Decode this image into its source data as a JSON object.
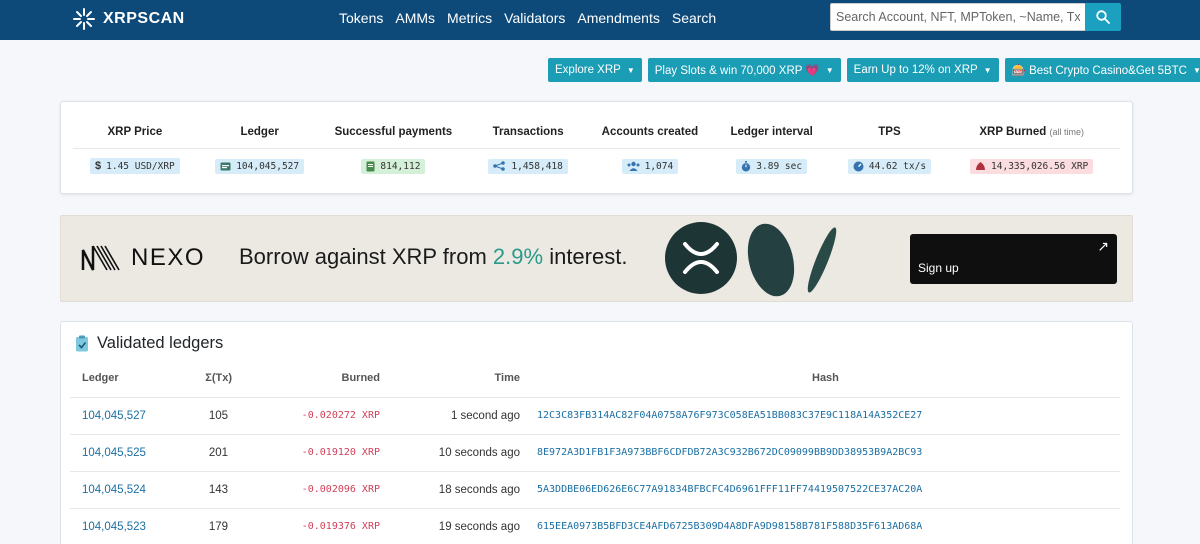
{
  "header": {
    "logo_text": "XRPSCAN",
    "nav": [
      "Tokens",
      "AMMs",
      "Metrics",
      "Validators",
      "Amendments",
      "Search"
    ],
    "search_placeholder": "Search Account, NFT, MPToken, ~Name, Tx H..."
  },
  "promos": [
    {
      "label": "Explore XRP"
    },
    {
      "label": "Play Slots & win 70,000 XRP 💗"
    },
    {
      "label": "Earn Up to 12% on XRP"
    },
    {
      "label": "🎰 Best Crypto Casino&Get 5BTC"
    }
  ],
  "stats": [
    {
      "label": "XRP Price",
      "value": "1.45 USD/XRP",
      "icon": "dollar-icon",
      "color": "blue"
    },
    {
      "label": "Ledger",
      "value": "104,045,527",
      "icon": "ledger-icon",
      "color": "blue"
    },
    {
      "label": "Successful payments",
      "value": "814,112",
      "icon": "payment-icon",
      "color": "green"
    },
    {
      "label": "Transactions",
      "value": "1,458,418",
      "icon": "network-icon",
      "color": "blue"
    },
    {
      "label": "Accounts created",
      "value": "1,074",
      "icon": "users-icon",
      "color": "blue"
    },
    {
      "label": "Ledger interval",
      "value": "3.89 sec",
      "icon": "stopwatch-icon",
      "color": "blue"
    },
    {
      "label": "TPS",
      "value": "44.62 tx/s",
      "icon": "gauge-icon",
      "color": "blue"
    },
    {
      "label": "XRP Burned",
      "sub": "(all time)",
      "value": "14,335,026.56 XRP",
      "icon": "fire-icon",
      "color": "red"
    }
  ],
  "banner": {
    "brand": "NEXO",
    "tagline_pre": "Borrow against XRP from ",
    "tagline_hl": "2.9%",
    "tagline_post": " interest.",
    "cta": "Sign up"
  },
  "ledgers": {
    "title": "Validated ledgers",
    "columns": {
      "ledger": "Ledger",
      "tx": "Σ(Tx)",
      "burned": "Burned",
      "time": "Time",
      "hash": "Hash"
    },
    "rows": [
      {
        "ledger": "104,045,527",
        "tx": "105",
        "burned": "-0.020272 XRP",
        "time": "1 second ago",
        "hash": "12C3C83FB314AC82F04A0758A76F973C058EA51BB083C37E9C118A14A352CE27"
      },
      {
        "ledger": "104,045,525",
        "tx": "201",
        "burned": "-0.019120 XRP",
        "time": "10 seconds ago",
        "hash": "8E972A3D1FB1F3A973BBF6CDFDB72A3C932B672DC09099BB9DD38953B9A2BC93"
      },
      {
        "ledger": "104,045,524",
        "tx": "143",
        "burned": "-0.002096 XRP",
        "time": "18 seconds ago",
        "hash": "5A3DDBE06ED626E6C77A91834BFBCFC4D6961FFF11FF74419507522CE37AC20A"
      },
      {
        "ledger": "104,045,523",
        "tx": "179",
        "burned": "-0.019376 XRP",
        "time": "19 seconds ago",
        "hash": "615EEA0973B5BFD3CE4AFD6725B309D4A8DFA9D98158B781F588D35F613AD68A"
      }
    ]
  }
}
